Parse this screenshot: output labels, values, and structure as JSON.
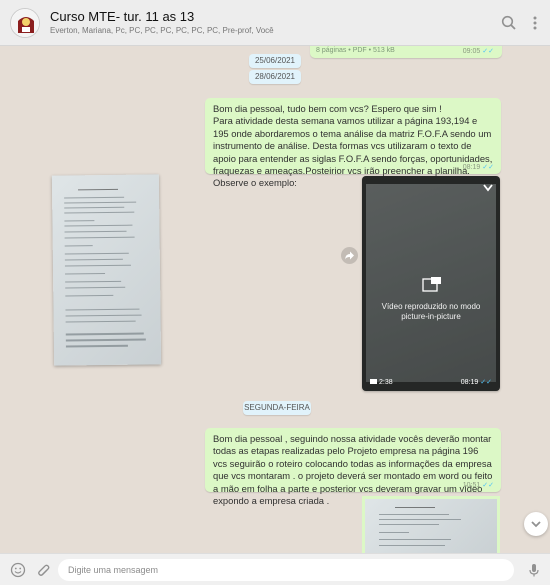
{
  "header": {
    "title": "Curso MTE- tur. 11 as 13",
    "participants": "Everton, Mariana, Pc, PC, PC, PC, PC, PC, PC, Pre-prof, Você"
  },
  "messages": {
    "doc_meta": "8 páginas • PDF • 513 kB",
    "doc_time": "09:05",
    "date_1": "25/06/2021",
    "date_2": "28/06/2021",
    "msg1_text": "Bom dia pessoal, tudo bem com vcs? Espero que sim !\nPara atividade desta semana vamos utilizar a página 193,194 e 195 onde abordaremos o tema  análise da matriz F.O.F.A sendo um instrumento de análise. Desta formas vcs utilizaram o texto de apoio para entender as siglas F.O.F.A sendo forças, oportunidades, fraquezas e ameaças.Posteirior vcs irão preencher a planilha.   Observe o exemplo:",
    "msg1_time": "08:19",
    "video_overlay": "Vídeo reproduzido no modo\npicture-in-picture",
    "video_duration": "2:38",
    "video_time": "08:19",
    "date_3": "SEGUNDA-FEIRA",
    "msg2_text": "Bom dia pessoal , seguindo nossa atividade vocês deverão montar todas as etapas realizadas pelo Projeto empresa na página 196 vcs seguirão o roteiro colocando todas as informações da empresa que vcs montaram . o projeto deverá ser montado em word ou feito a mão em folha a parte e posterior vcs deveram gravar um vídeo expondo a empresa criada .",
    "msg2_time": "10:51"
  },
  "footer": {
    "placeholder": "Digite uma mensagem"
  },
  "colors": {
    "outgoing_bubble": "#dcf8c6",
    "chat_background": "#e5ddd5",
    "read_ticks": "#4fc3f7"
  },
  "icons": [
    "group-avatar-icon",
    "search-icon",
    "menu-icon",
    "forward-icon",
    "pip-icon",
    "video-camera-icon",
    "expand-icon",
    "scroll-down-icon",
    "emoji-icon",
    "attach-icon",
    "mic-icon"
  ]
}
